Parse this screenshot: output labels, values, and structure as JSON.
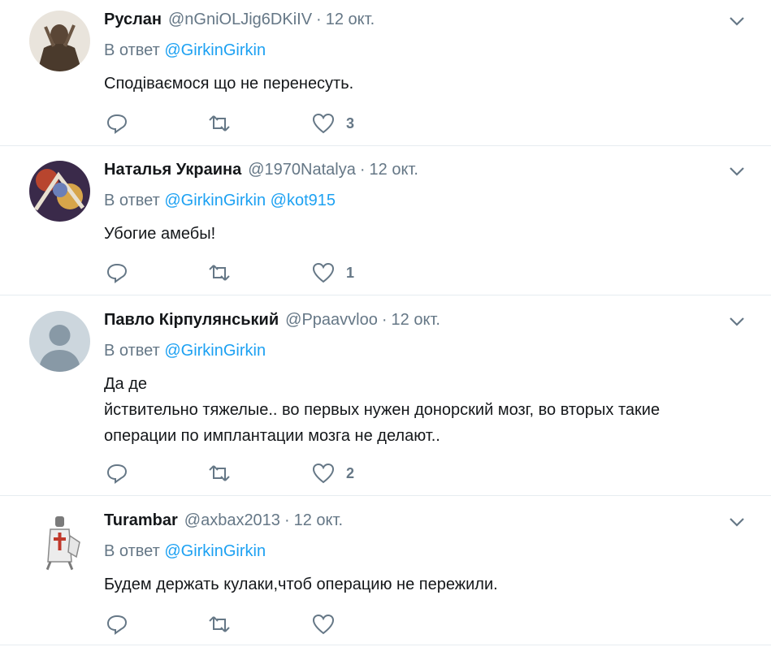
{
  "colors": {
    "link": "#1da1f2",
    "secondary": "#657786",
    "text": "#14171a",
    "divider": "#e6ecf0"
  },
  "icons": {
    "reply": "reply-icon",
    "retweet": "retweet-icon",
    "like": "heart-icon",
    "caret": "chevron-down-icon"
  },
  "tweets": [
    {
      "name": "Руслан",
      "handle": "@nGniOLJig6DKiIV",
      "sep": "·",
      "time": "12 окт.",
      "reply_prefix": "В ответ",
      "reply_to": [
        "@GirkinGirkin"
      ],
      "text": [
        "Сподіваємося що не перенесуть."
      ],
      "likes": "3"
    },
    {
      "name": "Наталья Украина",
      "handle": "@1970Natalya",
      "sep": "·",
      "time": "12 окт.",
      "reply_prefix": "В ответ",
      "reply_to": [
        "@GirkinGirkin",
        "@kot915"
      ],
      "text": [
        "Убогие амебы!"
      ],
      "likes": "1"
    },
    {
      "name": "Павло Кірпулянський",
      "handle": "@Ppaavvloo",
      "sep": "·",
      "time": "12 окт.",
      "reply_prefix": "В ответ",
      "reply_to": [
        "@GirkinGirkin"
      ],
      "text": [
        "Да де",
        "йствительно тяжелые.. во первых нужен донорский мозг, во вторых такие",
        "операции по имплантации мозга не делают.."
      ],
      "likes": "2"
    },
    {
      "name": "Turambar",
      "handle": "@axbax2013",
      "sep": "·",
      "time": "12 окт.",
      "reply_prefix": "В ответ",
      "reply_to": [
        "@GirkinGirkin"
      ],
      "text": [
        "Будем держать кулаки,чтоб операцию не пережили."
      ],
      "likes": ""
    }
  ]
}
